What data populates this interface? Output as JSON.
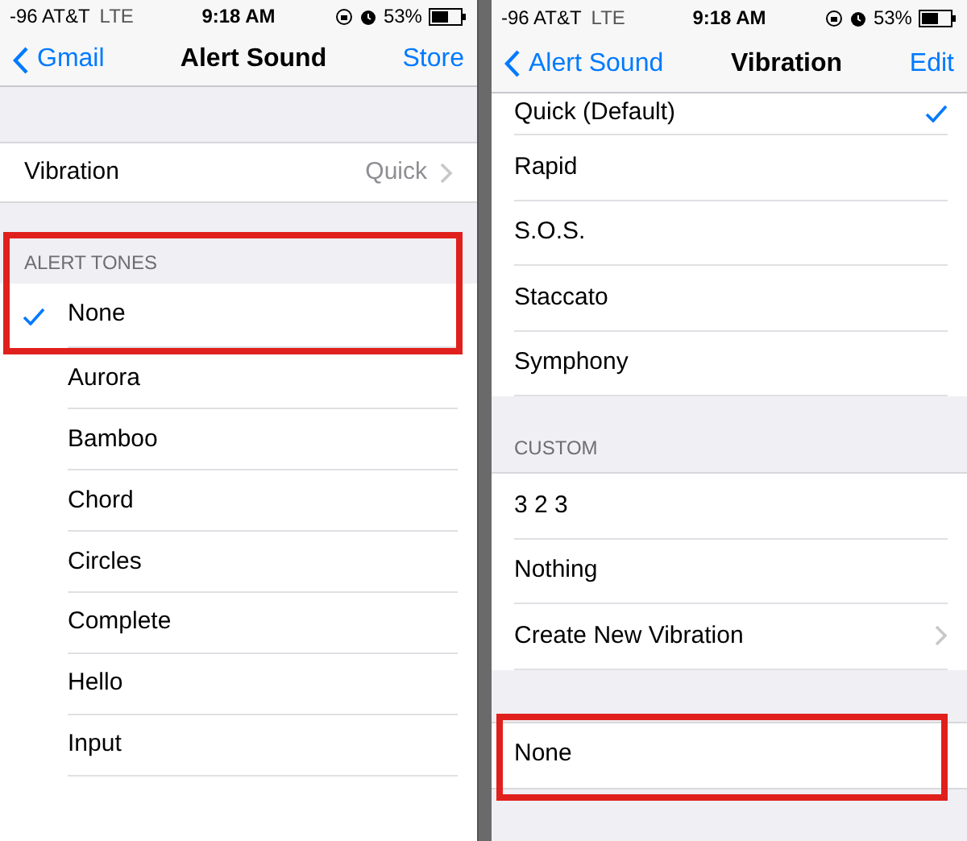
{
  "left": {
    "status": {
      "carrier": "-96 AT&T",
      "network": "LTE",
      "time": "9:18 AM",
      "battery": "53%"
    },
    "nav": {
      "back": "Gmail",
      "title": "Alert Sound",
      "action": "Store"
    },
    "settings": [
      {
        "label": "Vibration",
        "value": "Quick"
      }
    ],
    "section": {
      "header": "ALERT TONES",
      "header_highlighted": true,
      "items": [
        {
          "label": "None",
          "selected": true,
          "highlighted": true
        },
        {
          "label": "Aurora",
          "selected": false,
          "highlighted": false
        },
        {
          "label": "Bamboo",
          "selected": false,
          "highlighted": false
        },
        {
          "label": "Chord",
          "selected": false,
          "highlighted": false
        },
        {
          "label": "Circles",
          "selected": false,
          "highlighted": false
        },
        {
          "label": "Complete",
          "selected": false,
          "highlighted": false
        },
        {
          "label": "Hello",
          "selected": false,
          "highlighted": false
        },
        {
          "label": "Input",
          "selected": false,
          "highlighted": false
        }
      ]
    }
  },
  "right": {
    "status": {
      "carrier": "-96 AT&T",
      "network": "LTE",
      "time": "9:18 AM",
      "battery": "53%"
    },
    "nav": {
      "back": "Alert Sound",
      "title": "Vibration",
      "action": "Edit"
    },
    "standard": [
      {
        "label": "Quick (Default)",
        "selected": true
      },
      {
        "label": "Rapid",
        "selected": false
      },
      {
        "label": "S.O.S.",
        "selected": false
      },
      {
        "label": "Staccato",
        "selected": false
      },
      {
        "label": "Symphony",
        "selected": false
      }
    ],
    "custom": {
      "header": "CUSTOM",
      "items": [
        {
          "label": "3 2 3",
          "kind": "option"
        },
        {
          "label": "Nothing",
          "kind": "option"
        },
        {
          "label": "Create New Vibration",
          "kind": "link"
        }
      ]
    },
    "bottom": [
      {
        "label": "None",
        "highlighted": true
      }
    ]
  }
}
